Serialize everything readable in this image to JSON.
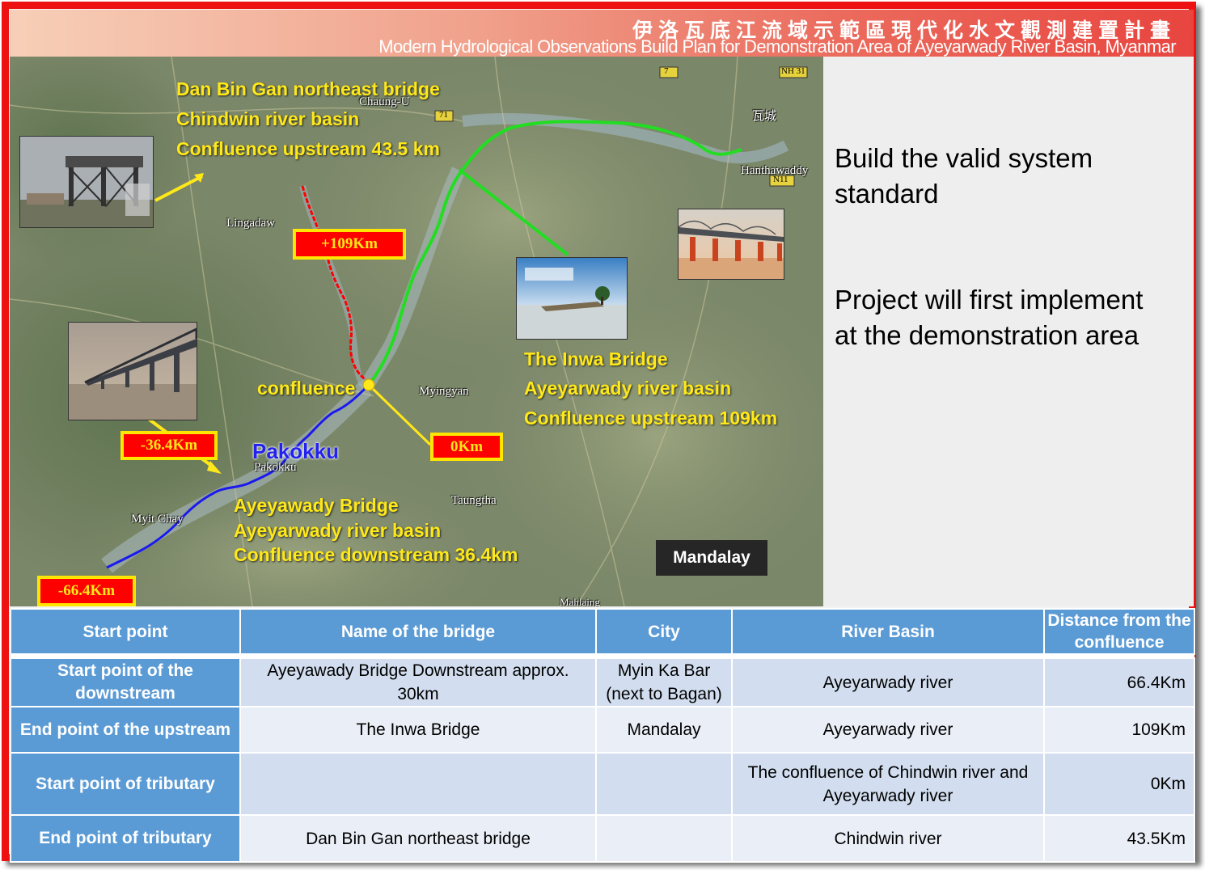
{
  "header": {
    "title_zh": "伊洛瓦底江流域示範區現代化水文觀測建置計畫",
    "title_en": "Modern Hydrological Observations Build Plan for Demonstration Area of Ayeyarwady River Basin, Myanmar"
  },
  "map": {
    "dan_bin_gan": [
      "Dan Bin Gan northeast bridge",
      "Chindwin river basin",
      "Confluence upstream 43.5 km"
    ],
    "inwa": [
      "The Inwa Bridge",
      "Ayeyarwady river basin",
      "Confluence upstream 109km"
    ],
    "ayeyawady": [
      "Ayeyawady Bridge",
      "Ayeyarwady river basin",
      "Confluence downstream 36.4km"
    ],
    "confluence_label": "confluence",
    "pakokku_label": "Pakokku",
    "mandalay_label": "Mandalay",
    "km_markers": {
      "plus109": "+109Km",
      "zero": "0Km",
      "minus36": "-36.4Km",
      "minus66": "-66.4Km"
    },
    "place_names": {
      "chaung_u": "Chaung-U",
      "lingadaw": "Lingadaw",
      "myinmu": "Myingyan",
      "pakokku_town": "Pakokku",
      "myit_chay": "Myit Chay",
      "taungtha": "Taungtha",
      "hanthawaddy": "Hanthawaddy",
      "mandalay_small": "瓦城",
      "road_71": "71",
      "road_7": "7",
      "road_nh31": "NH 31",
      "road_n11": "N11",
      "bottom_town": "Mahlaing"
    },
    "route_colors": {
      "chindwin": "#ff0000",
      "upstream": "#22dd22",
      "downstream": "#1a1aee",
      "confluence": "#ffe81a"
    }
  },
  "right_panel": {
    "line1": "Build the valid system",
    "line2": "standard",
    "line3": "Project will first implement",
    "line4": "at the demonstration area"
  },
  "table": {
    "headers": [
      "Start point",
      "Name of the bridge",
      "City",
      "River Basin",
      "Distance from the confluence"
    ],
    "rows": [
      {
        "start": "Start point of the downstream",
        "bridge": "Ayeyawady Bridge Downstream approx. 30km",
        "city": "Myin Ka Bar (next to Bagan)",
        "basin": "Ayeyarwady river",
        "distance": "66.4Km"
      },
      {
        "start": "End point of the upstream",
        "bridge": "The Inwa Bridge",
        "city": "Mandalay",
        "basin": "Ayeyarwady river",
        "distance": "109Km"
      },
      {
        "start": "Start point of tributary",
        "bridge": "",
        "city": "",
        "basin": "The confluence of Chindwin river and Ayeyarwady river",
        "distance": "0Km"
      },
      {
        "start": "End point of tributary",
        "bridge": "Dan Bin Gan northeast bridge",
        "city": "",
        "basin": "Chindwin river",
        "distance": "43.5Km"
      }
    ]
  }
}
